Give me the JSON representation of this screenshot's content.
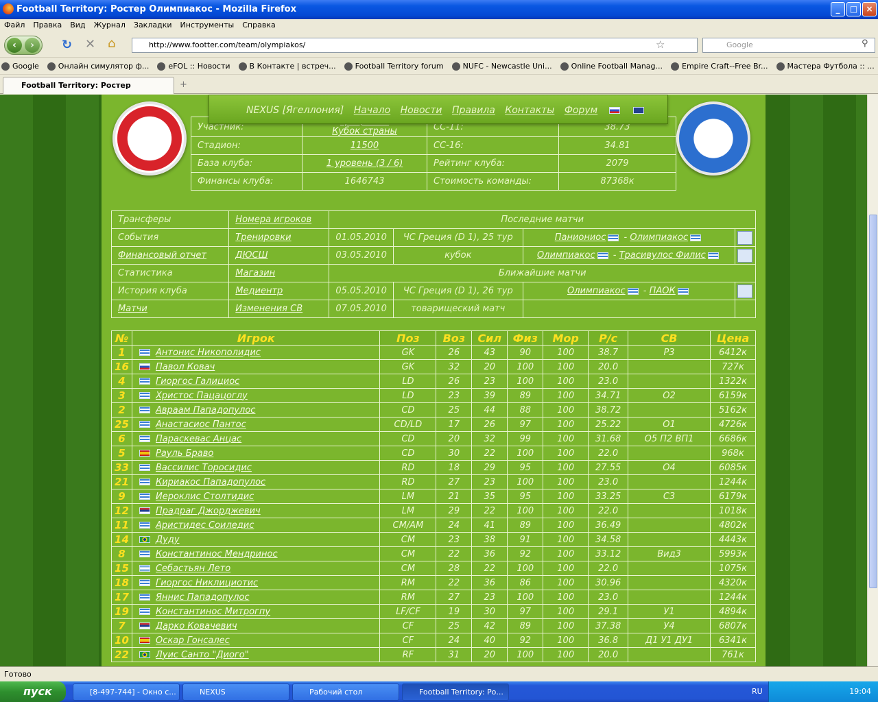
{
  "window": {
    "title": "Football Territory: Ростер Олимпиакос - Mozilla Firefox"
  },
  "menu": [
    "Файл",
    "Правка",
    "Вид",
    "Журнал",
    "Закладки",
    "Инструменты",
    "Справка"
  ],
  "url": "http://www.footter.com/team/olympiakos/",
  "search_placeholder": "Google",
  "bookmarks": [
    "Google",
    "Онлайн симулятор ф...",
    "eFOL :: Новости",
    "В Контакте | встреч...",
    "Football Territory forum",
    "NUFC - Newcastle Uni...",
    "Online Football Manag...",
    "Empire Craft--Free Br...",
    "Мастера Футбола :: ..."
  ],
  "tab": {
    "title": "Football Territory: Ростер Олимпиакос"
  },
  "site_nav": {
    "user": "NEXUS [Ягеллония]",
    "links": [
      "Начало",
      "Новости",
      "Правила",
      "Контакты",
      "Форум"
    ]
  },
  "club_info": {
    "participant_label": "Участник:",
    "participant_value1": "Греция D1",
    "participant_value2": "Кубок страны",
    "cc11_label": "СС-11:",
    "cc11_value": "38.73",
    "stadium_label": "Стадион:",
    "stadium_value": "11500",
    "cc16_label": "СС-16:",
    "cc16_value": "34.81",
    "base_label": "База клуба:",
    "base_value": "1 уровень (3 / 6)",
    "rating_label": "Рейтинг клуба:",
    "rating_value": "2079",
    "finance_label": "Финансы клуба:",
    "finance_value": "1646743",
    "cost_label": "Стоимость команды:",
    "cost_value": "87368к"
  },
  "menu_links": {
    "transfers": "Трансферы",
    "numbers": "Номера игроков",
    "events": "События",
    "training": "Тренировки",
    "fin_report": "Финансовый отчет",
    "youth": "ДЮСШ",
    "stats": "Статистика",
    "shop": "Магазин",
    "history": "История клуба",
    "media": "Медиентр",
    "matches": "Матчи",
    "sv_changes": "Изменения СВ",
    "last_matches": "Последние матчи",
    "next_matches": "Ближайшие матчи"
  },
  "last_matches": [
    {
      "date": "01.05.2010",
      "comp": "ЧС Греция (D 1), 25 тур",
      "home": "Паниониос",
      "away": "Олимпиакос"
    },
    {
      "date": "03.05.2010",
      "comp": "кубок",
      "home": "Олимпиакос",
      "away": "Трасивулос Филис"
    }
  ],
  "next_matches": [
    {
      "date": "05.05.2010",
      "comp": "ЧС Греция (D 1), 26 тур",
      "home": "Олимпиакос",
      "away": "ПАОК"
    },
    {
      "date": "07.05.2010",
      "comp": "товарищеский матч",
      "home": "",
      "away": ""
    }
  ],
  "roster_headers": [
    "№",
    "Игрок",
    "Поз",
    "Воз",
    "Сил",
    "Физ",
    "Мор",
    "Р/с",
    "СВ",
    "Цена"
  ],
  "roster": [
    {
      "num": "1",
      "flag": "gr",
      "name": "Антонис Никополидис",
      "pos": "GK",
      "age": "26",
      "str": "43",
      "fiz": "90",
      "mor": "100",
      "rs": "38.7",
      "sv": "Р3",
      "price": "6412к"
    },
    {
      "num": "16",
      "flag": "sk",
      "name": "Павол Ковач",
      "pos": "GK",
      "age": "32",
      "str": "20",
      "fiz": "100",
      "mor": "100",
      "rs": "20.0",
      "sv": "",
      "price": "727к"
    },
    {
      "num": "4",
      "flag": "gr",
      "name": "Гиоргос Галициос",
      "pos": "LD",
      "age": "26",
      "str": "23",
      "fiz": "100",
      "mor": "100",
      "rs": "23.0",
      "sv": "",
      "price": "1322к"
    },
    {
      "num": "3",
      "flag": "gr",
      "name": "Христос Пацацоглу",
      "pos": "LD",
      "age": "23",
      "str": "39",
      "fiz": "89",
      "mor": "100",
      "rs": "34.71",
      "sv": "О2",
      "price": "6159к"
    },
    {
      "num": "2",
      "flag": "gr",
      "name": "Авраам Пападопулос",
      "pos": "CD",
      "age": "25",
      "str": "44",
      "fiz": "88",
      "mor": "100",
      "rs": "38.72",
      "sv": "",
      "price": "5162к"
    },
    {
      "num": "25",
      "flag": "gr",
      "name": "Анастасиос Пантос",
      "pos": "CD/LD",
      "age": "17",
      "str": "26",
      "fiz": "97",
      "mor": "100",
      "rs": "25.22",
      "sv": "О1",
      "price": "4726к"
    },
    {
      "num": "6",
      "flag": "gr",
      "name": "Параскевас Анцас",
      "pos": "CD",
      "age": "20",
      "str": "32",
      "fiz": "99",
      "mor": "100",
      "rs": "31.68",
      "sv": "О5 П2 ВП1",
      "price": "6686к"
    },
    {
      "num": "5",
      "flag": "es",
      "name": "Рауль Браво",
      "pos": "CD",
      "age": "30",
      "str": "22",
      "fiz": "100",
      "mor": "100",
      "rs": "22.0",
      "sv": "",
      "price": "968к"
    },
    {
      "num": "33",
      "flag": "gr",
      "name": "Вассилис Торосидис",
      "pos": "RD",
      "age": "18",
      "str": "29",
      "fiz": "95",
      "mor": "100",
      "rs": "27.55",
      "sv": "О4",
      "price": "6085к"
    },
    {
      "num": "21",
      "flag": "gr",
      "name": "Кириакос Пападопулос",
      "pos": "RD",
      "age": "27",
      "str": "23",
      "fiz": "100",
      "mor": "100",
      "rs": "23.0",
      "sv": "",
      "price": "1244к"
    },
    {
      "num": "9",
      "flag": "gr",
      "name": "Иероклис Столтидис",
      "pos": "LM",
      "age": "21",
      "str": "35",
      "fiz": "95",
      "mor": "100",
      "rs": "33.25",
      "sv": "С3",
      "price": "6179к"
    },
    {
      "num": "12",
      "flag": "rs",
      "name": "Прадраг Джорджевич",
      "pos": "LM",
      "age": "29",
      "str": "22",
      "fiz": "100",
      "mor": "100",
      "rs": "22.0",
      "sv": "",
      "price": "1018к"
    },
    {
      "num": "11",
      "flag": "gr",
      "name": "Аристидес Соиледис",
      "pos": "CM/AM",
      "age": "24",
      "str": "41",
      "fiz": "89",
      "mor": "100",
      "rs": "36.49",
      "sv": "",
      "price": "4802к"
    },
    {
      "num": "14",
      "flag": "br",
      "name": "Дуду",
      "pos": "CM",
      "age": "23",
      "str": "38",
      "fiz": "91",
      "mor": "100",
      "rs": "34.58",
      "sv": "",
      "price": "4443к"
    },
    {
      "num": "8",
      "flag": "gr",
      "name": "Константинос Мендринос",
      "pos": "CM",
      "age": "22",
      "str": "36",
      "fiz": "92",
      "mor": "100",
      "rs": "33.12",
      "sv": "Вид3",
      "price": "5993к"
    },
    {
      "num": "15",
      "flag": "ar",
      "name": "Себастьян Лето",
      "pos": "CM",
      "age": "28",
      "str": "22",
      "fiz": "100",
      "mor": "100",
      "rs": "22.0",
      "sv": "",
      "price": "1075к"
    },
    {
      "num": "18",
      "flag": "gr",
      "name": "Гиоргос Никлициотис",
      "pos": "RM",
      "age": "22",
      "str": "36",
      "fiz": "86",
      "mor": "100",
      "rs": "30.96",
      "sv": "",
      "price": "4320к"
    },
    {
      "num": "17",
      "flag": "gr",
      "name": "Яннис Пападопулос",
      "pos": "RM",
      "age": "27",
      "str": "23",
      "fiz": "100",
      "mor": "100",
      "rs": "23.0",
      "sv": "",
      "price": "1244к"
    },
    {
      "num": "19",
      "flag": "gr",
      "name": "Константинос Митрогпу",
      "pos": "LF/CF",
      "age": "19",
      "str": "30",
      "fiz": "97",
      "mor": "100",
      "rs": "29.1",
      "sv": "У1",
      "price": "4894к"
    },
    {
      "num": "7",
      "flag": "rs",
      "name": "Дарко Ковачевич",
      "pos": "CF",
      "age": "25",
      "str": "42",
      "fiz": "89",
      "mor": "100",
      "rs": "37.38",
      "sv": "У4",
      "price": "6807к"
    },
    {
      "num": "10",
      "flag": "es",
      "name": "Оскар Гонсалес",
      "pos": "CF",
      "age": "24",
      "str": "40",
      "fiz": "92",
      "mor": "100",
      "rs": "36.8",
      "sv": "Д1 У1 ДУ1",
      "price": "6341к"
    },
    {
      "num": "22",
      "flag": "br",
      "name": "Луис Санто \"Диого\"",
      "pos": "RF",
      "age": "31",
      "str": "20",
      "fiz": "100",
      "mor": "100",
      "rs": "20.0",
      "sv": "",
      "price": "761к"
    }
  ],
  "status": "Готово",
  "taskbar": {
    "start": "пуск",
    "items": [
      "[8-497-744] - Окно с...",
      "NEXUS",
      "Рабочий стол",
      "Football Territory: Ро..."
    ],
    "lang": "RU",
    "time": "19:04"
  }
}
